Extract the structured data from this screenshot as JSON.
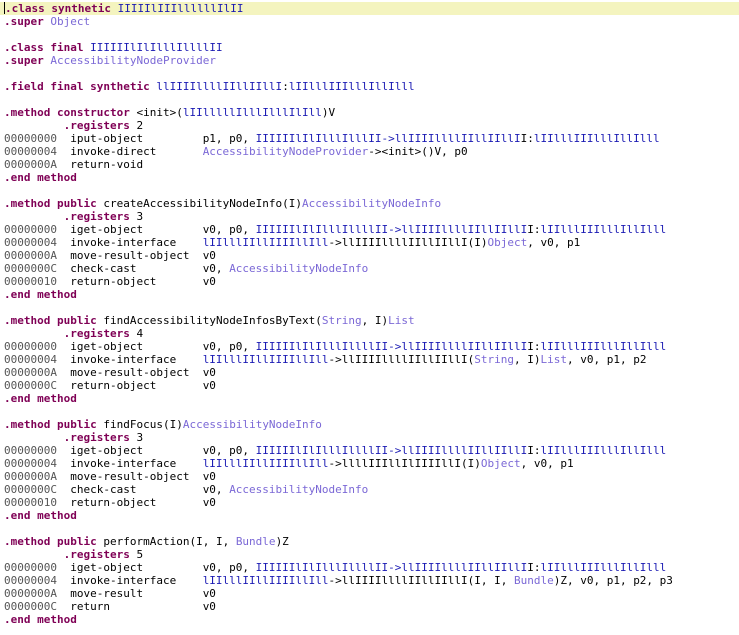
{
  "header": {
    "class_kw": ".class",
    "class_mods": "synthetic",
    "class_name": "IIIIIlIIIllllllIlII",
    "super_kw": ".super",
    "super_name": "Object",
    "class2_kw": ".class",
    "class2_mods": "final",
    "class2_name": "IIIIIIlIlIlllIllllII",
    "super2_kw": ".super",
    "super2_name": "AccessibilityNodeProvider",
    "field_kw": ".field",
    "field_mods": "final synthetic",
    "field_name": "llIIIIllllIIllIIllI",
    "field_colon": ":",
    "field_type": "lIIlllIIIlllIllIlll"
  },
  "methods": [
    {
      "kw": ".method",
      "mods": "constructor",
      "sig_pre": "<init>(",
      "sig_ob": "lIIlllllIlllIlllIlIll",
      "sig_post": ")V",
      "registers": ".registers 2",
      "rows": [
        {
          "addr": "00000000",
          "op": "iput-object",
          "args": [
            [
              "",
              "p1, p0, "
            ],
            [
              "ob",
              "IIIIIIlIlIlllIlllII->"
            ],
            [
              "ob",
              "llIIIIllllIIllIIllI"
            ],
            [
              "",
              "I:"
            ],
            [
              "ob",
              "lIIlllIIIlllIllIlll"
            ]
          ]
        },
        {
          "addr": "00000004",
          "op": "invoke-direct",
          "args": [
            [
              "tp",
              "AccessibilityNodeProvider"
            ],
            [
              "",
              "-><init>()V, p0"
            ]
          ]
        },
        {
          "addr": "0000000A",
          "op": "return-void",
          "args": []
        }
      ],
      "end": ".end method"
    },
    {
      "kw": ".method",
      "mods": "public",
      "name": "createAccessibilityNodeInfo(I)",
      "ret": "AccessibilityNodeInfo",
      "registers": ".registers 3",
      "rows": [
        {
          "addr": "00000000",
          "op": "iget-object",
          "args": [
            [
              "",
              "v0, p0, "
            ],
            [
              "ob",
              "IIIIIIlIlIlllIllllII->"
            ],
            [
              "ob",
              "llIIIIllllIIllIIllI"
            ],
            [
              "",
              "I:"
            ],
            [
              "ob",
              "lIIlllIIIlllIllIlll"
            ]
          ]
        },
        {
          "addr": "00000004",
          "op": "invoke-interface",
          "args": [
            [
              "ob",
              "lIIlllIIllIIIIllIll"
            ],
            [
              "",
              "->llIIIIllllIIllIIllI(I)"
            ],
            [
              "tp",
              "Object"
            ],
            [
              "",
              ", v0, p1"
            ]
          ]
        },
        {
          "addr": "0000000A",
          "op": "move-result-object",
          "args": [
            [
              "",
              "v0"
            ]
          ]
        },
        {
          "addr": "0000000C",
          "op": "check-cast",
          "args": [
            [
              "",
              "v0, "
            ],
            [
              "tp",
              "AccessibilityNodeInfo"
            ]
          ]
        },
        {
          "addr": "00000010",
          "op": "return-object",
          "args": [
            [
              "",
              "v0"
            ]
          ]
        }
      ],
      "end": ".end method"
    },
    {
      "kw": ".method",
      "mods": "public",
      "name": "findAccessibilityNodeInfosByText(",
      "params": [
        [
          "tp",
          "String"
        ],
        [
          "",
          ", I)"
        ],
        [
          "tp",
          "List"
        ]
      ],
      "registers": ".registers 4",
      "rows": [
        {
          "addr": "00000000",
          "op": "iget-object",
          "args": [
            [
              "",
              "v0, p0, "
            ],
            [
              "ob",
              "IIIIIIlIlIlllIllllII->"
            ],
            [
              "ob",
              "llIIIIllllIIllIIllI"
            ],
            [
              "",
              "I:"
            ],
            [
              "ob",
              "lIIlllIIIlllIllIlll"
            ]
          ]
        },
        {
          "addr": "00000004",
          "op": "invoke-interface",
          "args": [
            [
              "ob",
              "lIIlllIIllIIIIllIll"
            ],
            [
              "",
              "->llIIIIllllIIllIIllI("
            ],
            [
              "tp",
              "String"
            ],
            [
              "",
              ", I)"
            ],
            [
              "tp",
              "List"
            ],
            [
              "",
              ", v0, p1, p2"
            ]
          ]
        },
        {
          "addr": "0000000A",
          "op": "move-result-object",
          "args": [
            [
              "",
              "v0"
            ]
          ]
        },
        {
          "addr": "0000000C",
          "op": "return-object",
          "args": [
            [
              "",
              "v0"
            ]
          ]
        }
      ],
      "end": ".end method"
    },
    {
      "kw": ".method",
      "mods": "public",
      "name": "findFocus(I)",
      "ret": "AccessibilityNodeInfo",
      "registers": ".registers 3",
      "rows": [
        {
          "addr": "00000000",
          "op": "iget-object",
          "args": [
            [
              "",
              "v0, p0, "
            ],
            [
              "ob",
              "IIIIIIlIlIlllIllllII->"
            ],
            [
              "ob",
              "llIIIIllllIIllIIllI"
            ],
            [
              "",
              "I:"
            ],
            [
              "ob",
              "lIIlllIIIlllIllIlll"
            ]
          ]
        },
        {
          "addr": "00000004",
          "op": "invoke-interface",
          "args": [
            [
              "ob",
              "lIIlllIIllIIIIllIll"
            ],
            [
              "",
              "->llllIIIllIlIIIIllI(I)"
            ],
            [
              "tp",
              "Object"
            ],
            [
              "",
              ", v0, p1"
            ]
          ]
        },
        {
          "addr": "0000000A",
          "op": "move-result-object",
          "args": [
            [
              "",
              "v0"
            ]
          ]
        },
        {
          "addr": "0000000C",
          "op": "check-cast",
          "args": [
            [
              "",
              "v0, "
            ],
            [
              "tp",
              "AccessibilityNodeInfo"
            ]
          ]
        },
        {
          "addr": "00000010",
          "op": "return-object",
          "args": [
            [
              "",
              "v0"
            ]
          ]
        }
      ],
      "end": ".end method"
    },
    {
      "kw": ".method",
      "mods": "public",
      "name": "performAction(I, I, ",
      "params": [
        [
          "tp",
          "Bundle"
        ],
        [
          "",
          ")Z"
        ]
      ],
      "registers": ".registers 5",
      "rows": [
        {
          "addr": "00000000",
          "op": "iget-object",
          "args": [
            [
              "",
              "v0, p0, "
            ],
            [
              "ob",
              "IIIIIIlIlIlllIllllII->"
            ],
            [
              "ob",
              "llIIIIllllIIllIIllI"
            ],
            [
              "",
              "I:"
            ],
            [
              "ob",
              "lIIlllIIIlllIllIlll"
            ]
          ]
        },
        {
          "addr": "00000004",
          "op": "invoke-interface",
          "args": [
            [
              "ob",
              "lIIlllIIllIIIIllIll"
            ],
            [
              "",
              "->llIIIIllllIIllIIllI(I, I, "
            ],
            [
              "tp",
              "Bundle"
            ],
            [
              "",
              ")Z, v0, p1, p2, p3"
            ]
          ]
        },
        {
          "addr": "0000000A",
          "op": "move-result",
          "args": [
            [
              "",
              "v0"
            ]
          ]
        },
        {
          "addr": "0000000C",
          "op": "return",
          "args": [
            [
              "",
              "v0"
            ]
          ]
        }
      ],
      "end": ".end method"
    }
  ]
}
